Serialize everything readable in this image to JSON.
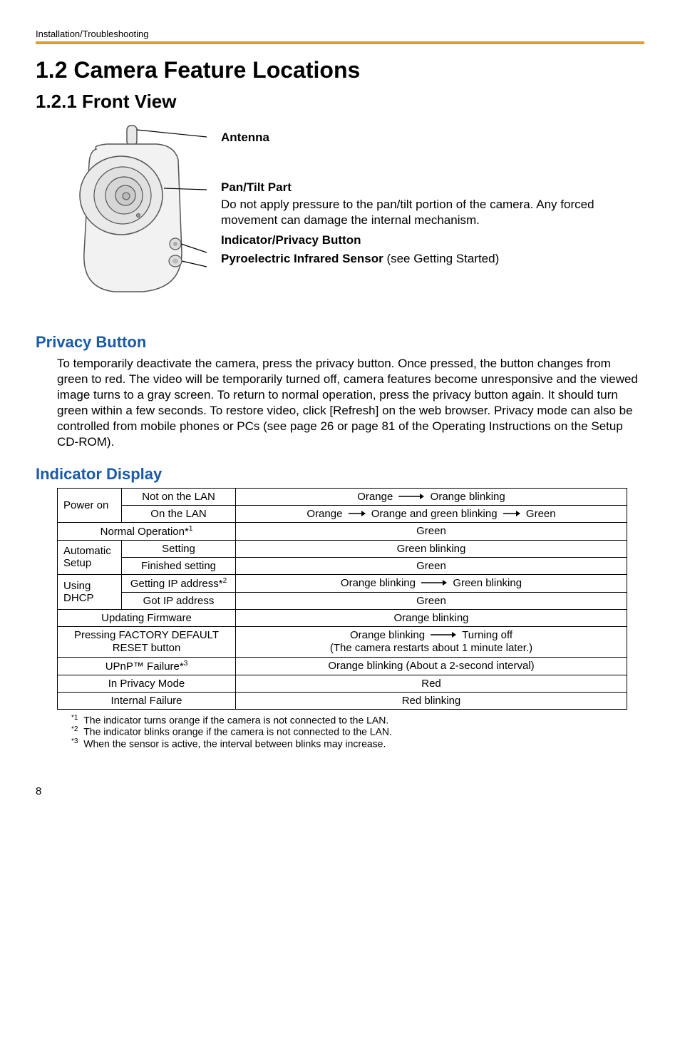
{
  "header": {
    "breadcrumb": "Installation/Troubleshooting"
  },
  "headings": {
    "h1": "1.2   Camera Feature Locations",
    "h2": "1.2.1   Front View"
  },
  "figure": {
    "antenna": "Antenna",
    "pan_title": "Pan/Tilt Part",
    "pan_desc": "Do not apply pressure to the pan/tilt portion of the camera. Any forced movement can damage the internal mechanism.",
    "indicator": "Indicator/Privacy Button",
    "pyro_bold": "Pyroelectric Infrared Sensor",
    "pyro_rest": " (see Getting Started)"
  },
  "privacy": {
    "title": "Privacy Button",
    "body": "To temporarily deactivate the camera, press the privacy button. Once pressed, the button changes from green to red. The video will be temporarily turned off, camera features become unresponsive and the viewed image turns to a gray screen. To return to normal operation, press the privacy button again. It should turn green within a few seconds. To restore video, click [Refresh] on the web browser. Privacy mode can also be controlled from mobile phones or PCs (see page 26 or page 81 of the Operating Instructions on the Setup CD-ROM)."
  },
  "indicator": {
    "title": "Indicator Display"
  },
  "table": {
    "power_on": "Power on",
    "not_on_lan": "Not on the LAN",
    "not_on_lan_val_a": "Orange",
    "not_on_lan_val_b": "Orange blinking",
    "on_lan": "On the LAN",
    "on_lan_val_a": "Orange",
    "on_lan_val_b": "Orange and green blinking",
    "on_lan_val_c": "Green",
    "normal_op": "Normal Operation*",
    "normal_op_sup": "1",
    "normal_op_val": "Green",
    "auto_setup": "Automatic Setup",
    "setting": "Setting",
    "setting_val": "Green blinking",
    "finished": "Finished setting",
    "finished_val": "Green",
    "using_dhcp": "Using DHCP",
    "getting_ip": "Getting IP address*",
    "getting_ip_sup": "2",
    "getting_ip_val_a": "Orange blinking",
    "getting_ip_val_b": "Green blinking",
    "got_ip": "Got IP address",
    "got_ip_val": "Green",
    "updating": "Updating Firmware",
    "updating_val": "Orange blinking",
    "factory": "Pressing FACTORY DEFAULT RESET button",
    "factory_val_a": "Orange blinking",
    "factory_val_b": "Turning off",
    "factory_val_line2": "(The camera restarts about 1 minute later.)",
    "upnp": "UPnP™ Failure*",
    "upnp_sup": "3",
    "upnp_val": "Orange blinking (About a 2-second interval)",
    "privacy_mode": "In Privacy Mode",
    "privacy_mode_val": "Red",
    "internal": "Internal Failure",
    "internal_val": "Red blinking"
  },
  "footnotes": {
    "f1_sup": "*1",
    "f1": "The indicator turns orange if the camera is not connected to the LAN.",
    "f2_sup": "*2",
    "f2": "The indicator blinks orange if the camera is not connected to the LAN.",
    "f3_sup": "*3",
    "f3": "When the sensor is active, the interval between blinks may increase."
  },
  "page": {
    "num": "8"
  }
}
